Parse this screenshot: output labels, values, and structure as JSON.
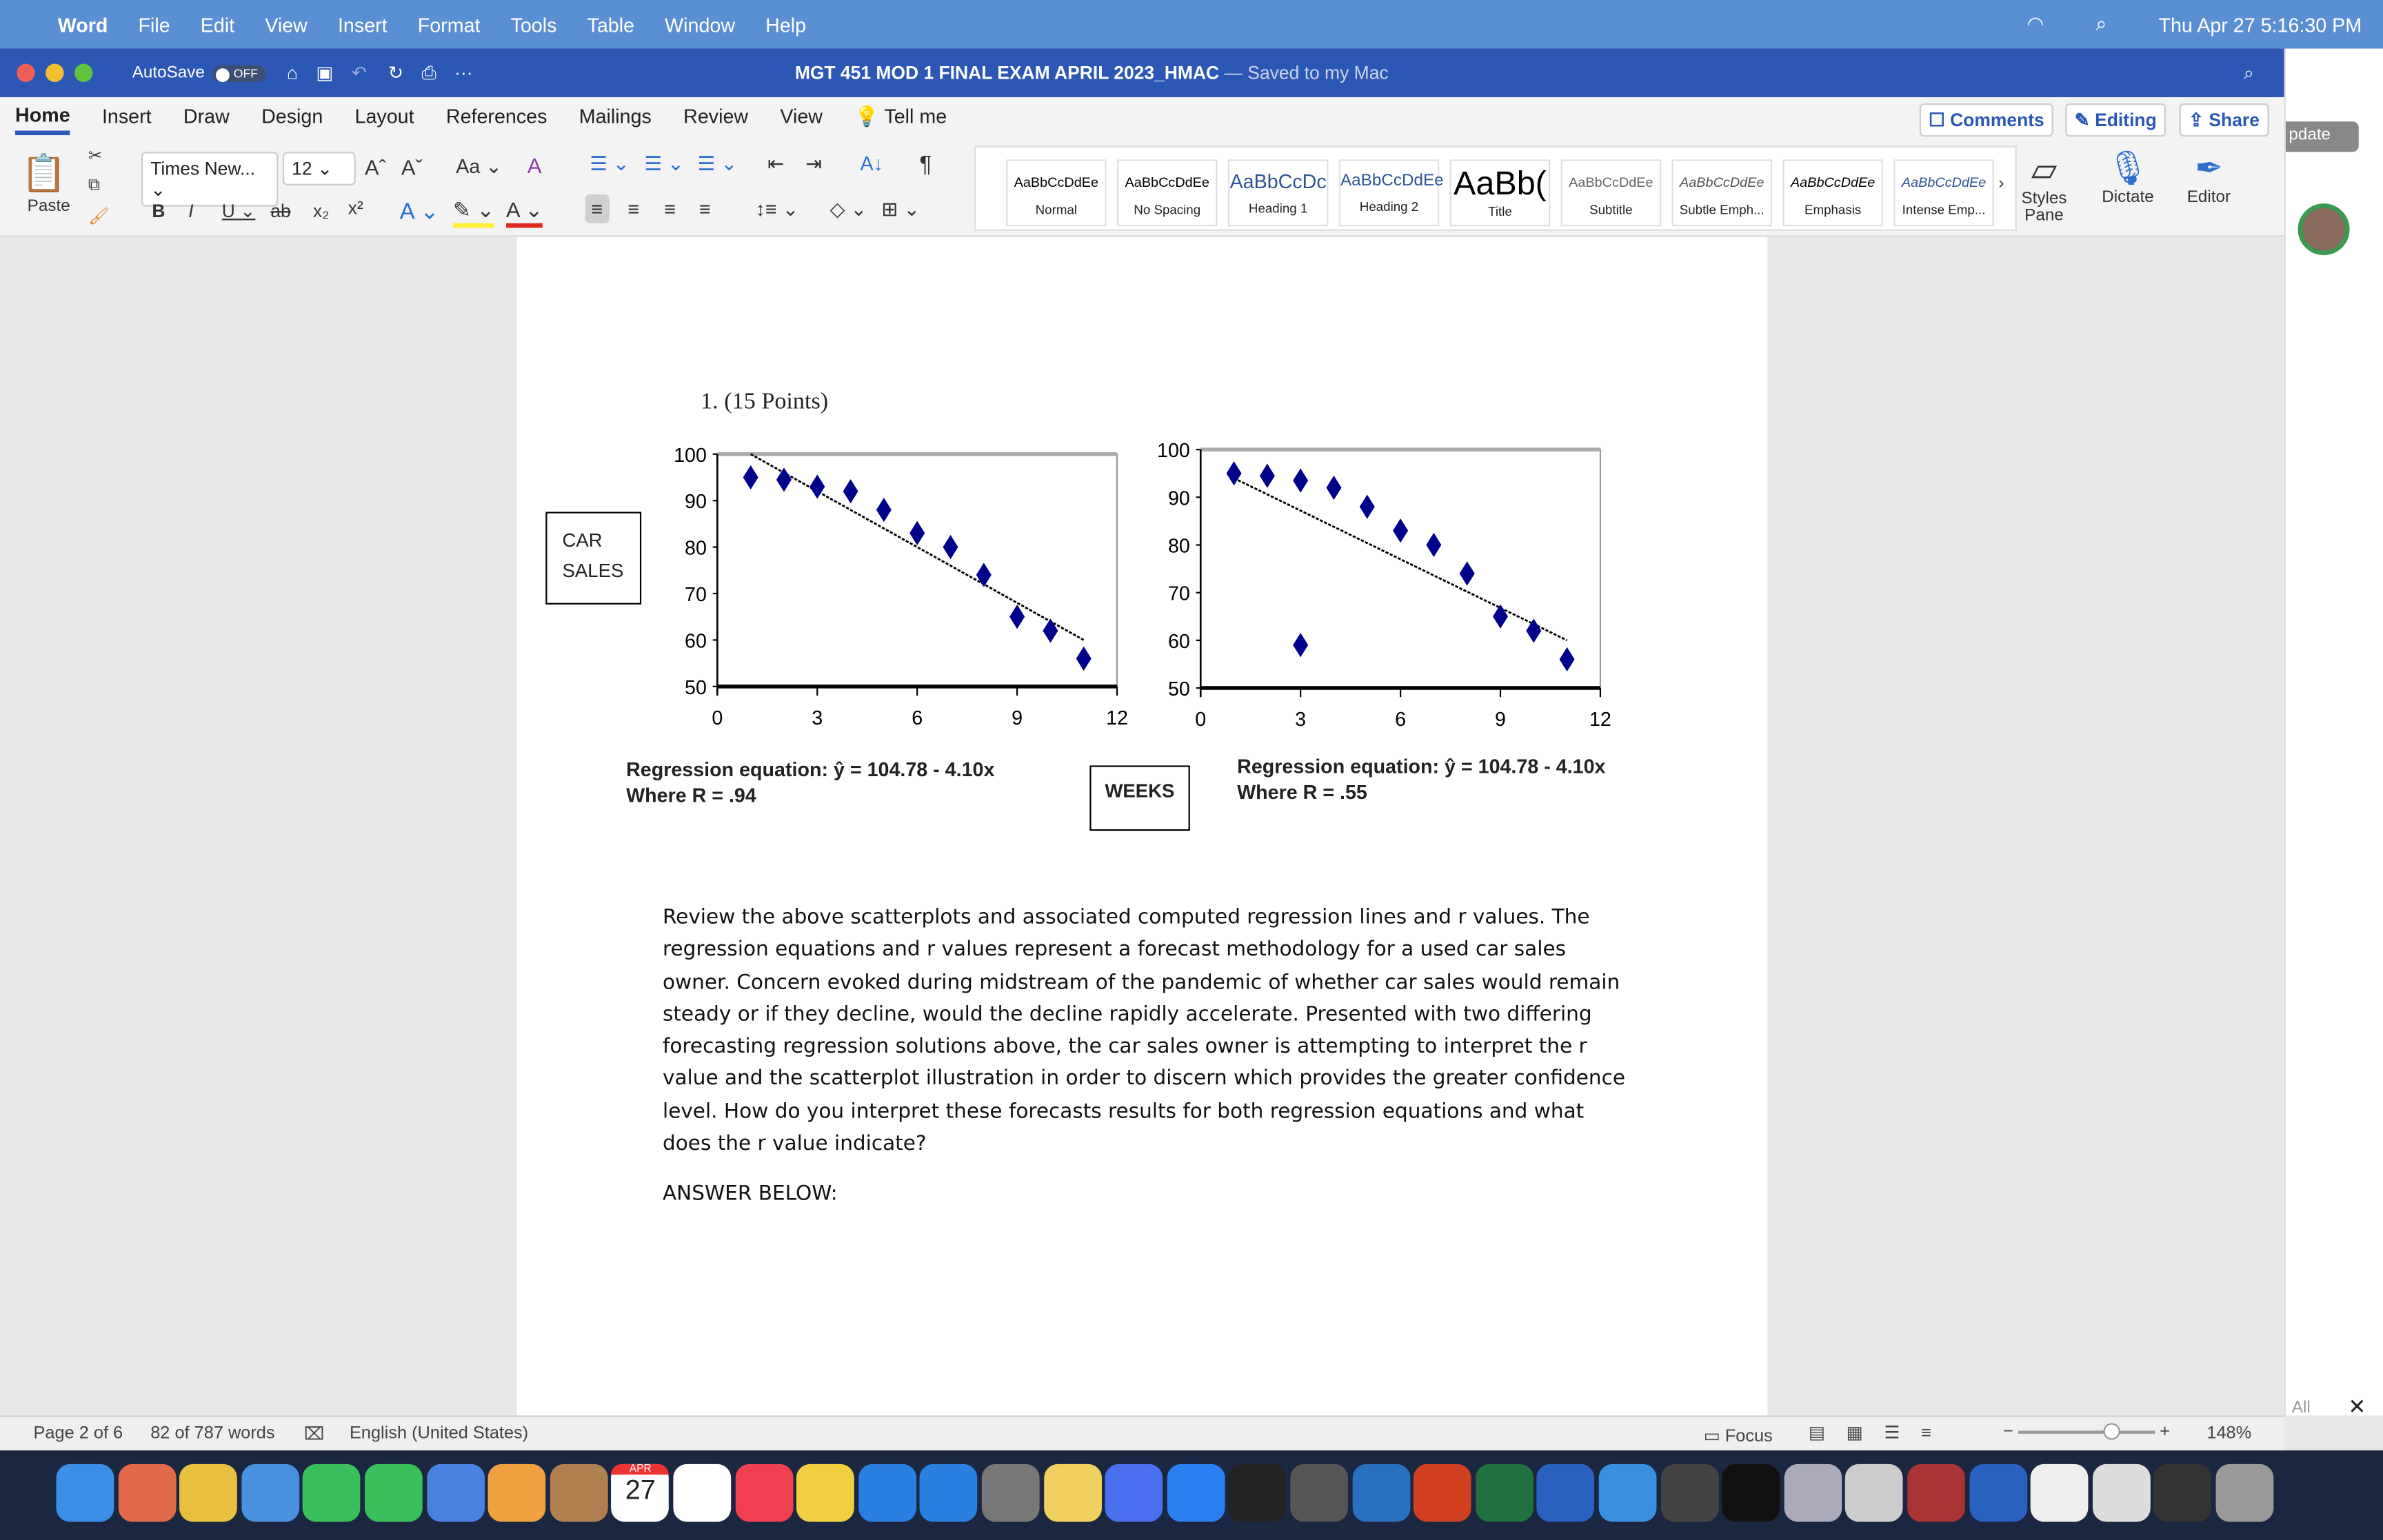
{
  "menubar": {
    "app": "Word",
    "items": [
      "File",
      "Edit",
      "View",
      "Insert",
      "Format",
      "Tools",
      "Table",
      "Window",
      "Help"
    ],
    "clock": "Thu Apr 27  5:16:30 PM"
  },
  "titlebar": {
    "autosave": "AutoSave",
    "autosave_state": "OFF",
    "title": "MGT 451 MOD 1 FINAL EXAM APRIL 2023_HMAC",
    "saved": "— Saved to my Mac"
  },
  "tabs": [
    "Home",
    "Insert",
    "Draw",
    "Design",
    "Layout",
    "References",
    "Mailings",
    "Review",
    "View",
    "Tell me"
  ],
  "actions": {
    "comments": "Comments",
    "editing": "Editing",
    "share": "Share",
    "update": "pdate"
  },
  "ribbon": {
    "paste": "Paste",
    "font": "Times New...",
    "size": "12",
    "case": "Aa",
    "styles": [
      {
        "sample": "AaBbCcDdEe",
        "name": "Normal"
      },
      {
        "sample": "AaBbCcDdEe",
        "name": "No Spacing"
      },
      {
        "sample": "AaBbCcDc",
        "name": "Heading 1"
      },
      {
        "sample": "AaBbCcDdEe",
        "name": "Heading 2"
      },
      {
        "sample": "AaBb(",
        "name": "Title"
      },
      {
        "sample": "AaBbCcDdEe",
        "name": "Subtitle"
      },
      {
        "sample": "AaBbCcDdEe",
        "name": "Subtle Emph..."
      },
      {
        "sample": "AaBbCcDdEe",
        "name": "Emphasis"
      },
      {
        "sample": "AaBbCcDdEe",
        "name": "Intense Emp..."
      }
    ],
    "styles_pane": "Styles Pane",
    "dictate": "Dictate",
    "editor": "Editor"
  },
  "document": {
    "question": "1.   (15 Points)",
    "y_label": [
      "CAR",
      "SALES"
    ],
    "x_label": "WEEKS",
    "eq1": [
      "Regression equation: ŷ = 104.78 - 4.10x",
      "Where R = .94"
    ],
    "eq2": [
      "Regression equation: ŷ = 104.78 - 4.10x",
      "Where R = .55"
    ],
    "paragraph": "Review the above scatterplots and associated computed regression lines and r values.  The regression equations and r values represent a forecast methodology for a used car sales owner. Concern evoked during midstream of the pandemic of whether car sales would remain steady or if they decline, would the decline rapidly accelerate.  Presented with two differing forecasting regression solutions above, the car sales owner is attempting to interpret the r value and the scatterplot illustration in order to discern which provides the greater confidence level.  How do you interpret these forecasts results for both regression equations and what does the r value indicate?",
    "answer": "ANSWER BELOW:"
  },
  "chart_data": [
    {
      "type": "scatter",
      "xlim": [
        0,
        12
      ],
      "ylim": [
        50,
        100
      ],
      "xticks": [
        "0",
        "3",
        "6",
        "9",
        "12"
      ],
      "yticks": [
        "50",
        "60",
        "70",
        "80",
        "90",
        "100"
      ],
      "marker_color": "#00008b",
      "x": [
        1,
        2,
        3,
        4,
        5,
        6,
        7,
        8,
        9,
        10,
        11
      ],
      "y": [
        95,
        94.5,
        93,
        92,
        88,
        83,
        80,
        74,
        65,
        62,
        56
      ],
      "trendline": [
        [
          1,
          100
        ],
        [
          11,
          60
        ]
      ]
    },
    {
      "type": "scatter",
      "xlim": [
        0,
        12
      ],
      "ylim": [
        50,
        100
      ],
      "xticks": [
        "0",
        "3",
        "6",
        "9",
        "12"
      ],
      "yticks": [
        "50",
        "60",
        "70",
        "80",
        "90",
        "100"
      ],
      "marker_color": "#00008b",
      "x": [
        1,
        2,
        3,
        4,
        5,
        6,
        7,
        8,
        3,
        9,
        10,
        11
      ],
      "y": [
        95,
        94.5,
        93.5,
        92,
        88,
        83,
        80,
        74,
        59,
        65,
        62,
        56
      ],
      "trendline": [
        [
          1,
          94
        ],
        [
          11,
          60
        ]
      ]
    }
  ],
  "status": {
    "page": "Page 2 of 6",
    "words": "82 of 787 words",
    "language": "English (United States)",
    "focus": "Focus",
    "zoom": "148%",
    "all": "All"
  },
  "dock": {
    "calendar_month": "APR",
    "calendar_day": "27"
  }
}
